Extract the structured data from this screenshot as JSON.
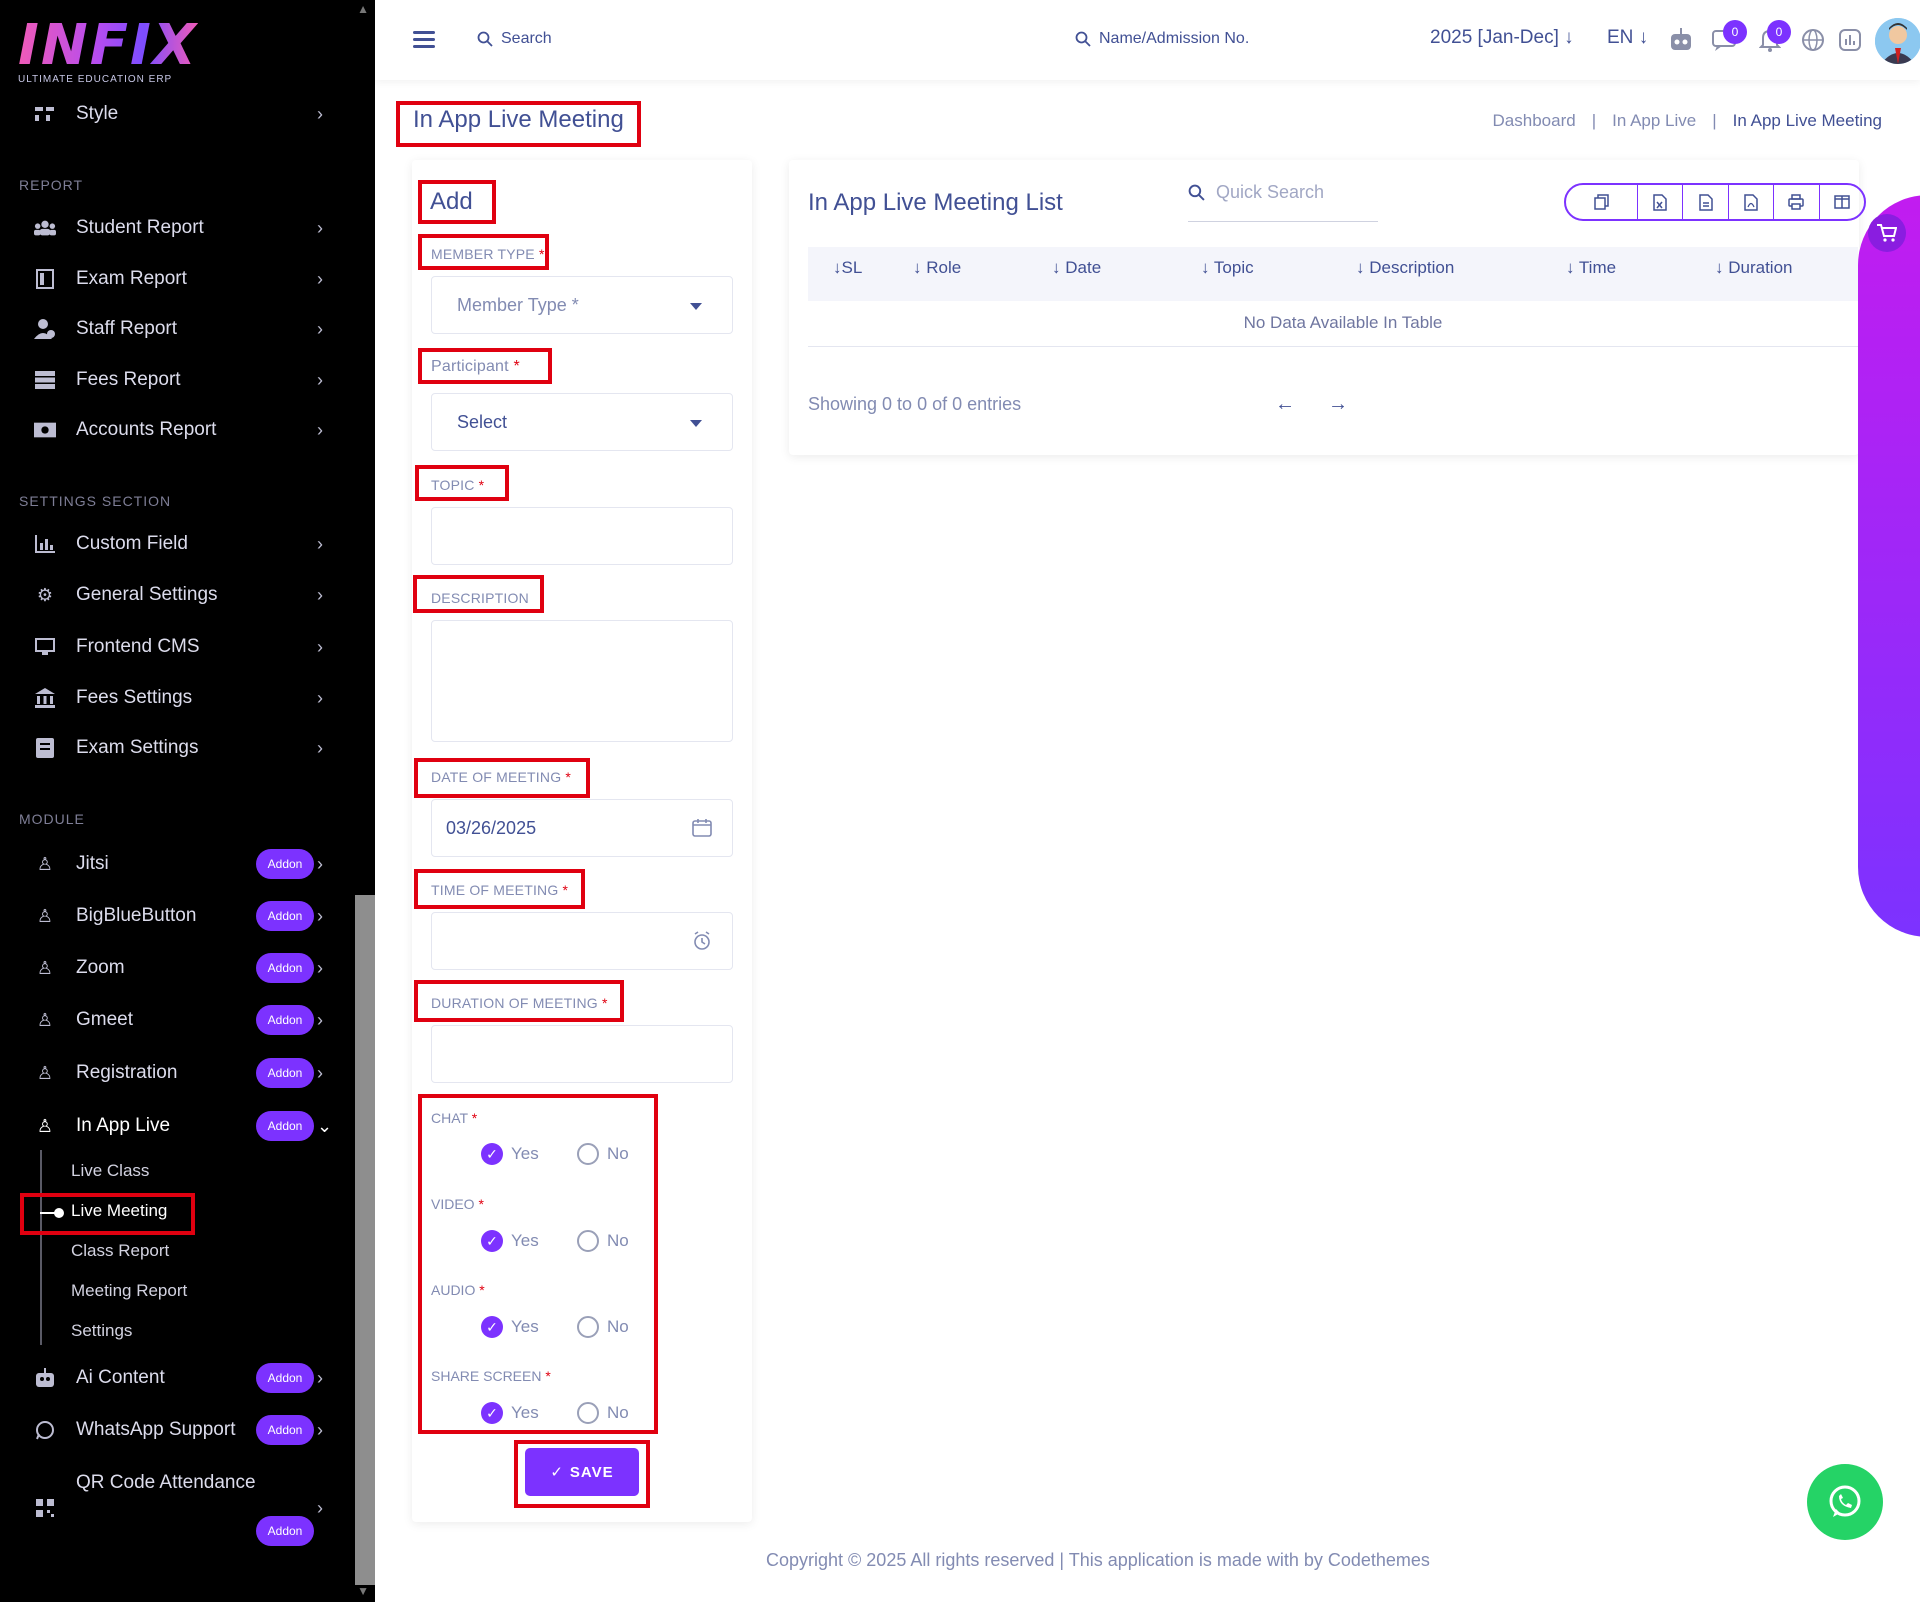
{
  "app": {
    "logo_text": "INFIX",
    "logo_subtitle": "ULTIMATE EDUCATION ERP"
  },
  "sidebar": {
    "style_item": "Style",
    "report_title": "REPORT",
    "report_items": [
      {
        "label": "Student Report",
        "icon": "users-icon"
      },
      {
        "label": "Exam Report",
        "icon": "exam-icon"
      },
      {
        "label": "Staff Report",
        "icon": "staff-icon"
      },
      {
        "label": "Fees Report",
        "icon": "server-icon"
      },
      {
        "label": "Accounts Report",
        "icon": "money-icon"
      }
    ],
    "settings_title": "SETTINGS SECTION",
    "settings_items": [
      {
        "label": "Custom Field",
        "icon": "chart-icon"
      },
      {
        "label": "General Settings",
        "icon": "gears-icon"
      },
      {
        "label": "Frontend CMS",
        "icon": "monitor-icon"
      },
      {
        "label": "Fees Settings",
        "icon": "bank-icon"
      },
      {
        "label": "Exam Settings",
        "icon": "book-icon"
      }
    ],
    "module_title": "MODULE",
    "module_items": [
      {
        "label": "Jitsi",
        "badge": "Addon"
      },
      {
        "label": "BigBlueButton",
        "badge": "Addon"
      },
      {
        "label": "Zoom",
        "badge": "Addon"
      },
      {
        "label": "Gmeet",
        "badge": "Addon"
      },
      {
        "label": "Registration",
        "badge": "Addon"
      },
      {
        "label": "In App Live",
        "badge": "Addon"
      }
    ],
    "sub_items": [
      "Live Class",
      "Live Meeting",
      "Class Report",
      "Meeting Report",
      "Settings"
    ],
    "bottom_items": [
      {
        "label": "Ai Content",
        "badge": "Addon"
      },
      {
        "label": "WhatsApp Support",
        "badge": "Addon"
      },
      {
        "label": "QR Code Attendance",
        "badge": "Addon"
      }
    ]
  },
  "header": {
    "search_label": "Search",
    "search2_label": "Name/Admission No.",
    "year": "2025 [Jan-Dec]",
    "lang": "EN",
    "chat_count": "0",
    "notif_count": "0"
  },
  "page": {
    "title": "In App Live Meeting",
    "breadcrumb": [
      "Dashboard",
      "In App Live",
      "In App Live Meeting"
    ]
  },
  "form": {
    "title": "Add",
    "member_type_label": "MEMBER TYPE",
    "member_type_placeholder": "Member Type *",
    "participant_label": "Participant",
    "participant_value": "Select",
    "topic_label": "TOPIC",
    "description_label": "DESCRIPTION",
    "date_label": "DATE OF MEETING",
    "date_value": "03/26/2025",
    "time_label": "TIME OF MEETING",
    "duration_label": "DURATION OF MEETING",
    "required_mark": "*",
    "radios": [
      {
        "label": "CHAT",
        "selected": "Yes"
      },
      {
        "label": "VIDEO",
        "selected": "Yes"
      },
      {
        "label": "AUDIO",
        "selected": "Yes"
      },
      {
        "label": "SHARE SCREEN",
        "selected": "Yes"
      }
    ],
    "yes": "Yes",
    "no": "No",
    "save_label": "SAVE"
  },
  "list": {
    "title": "In App Live Meeting List",
    "search_placeholder": "Quick Search",
    "columns": [
      "SL",
      "Role",
      "Date",
      "Topic",
      "Description",
      "Time",
      "Duration"
    ],
    "empty": "No Data Available In Table",
    "showing": "Showing 0 to 0 of 0 entries",
    "export_buttons": [
      "copy-icon",
      "excel-icon",
      "csv-icon",
      "pdf-icon",
      "print-icon",
      "columns-icon"
    ]
  },
  "footer": {
    "text": "Copyright © 2025 All rights reserved | This application is made with by Codethemes"
  },
  "colors": {
    "primary": "#7c32ff",
    "text": "#415094",
    "highlight": "#e00010"
  }
}
